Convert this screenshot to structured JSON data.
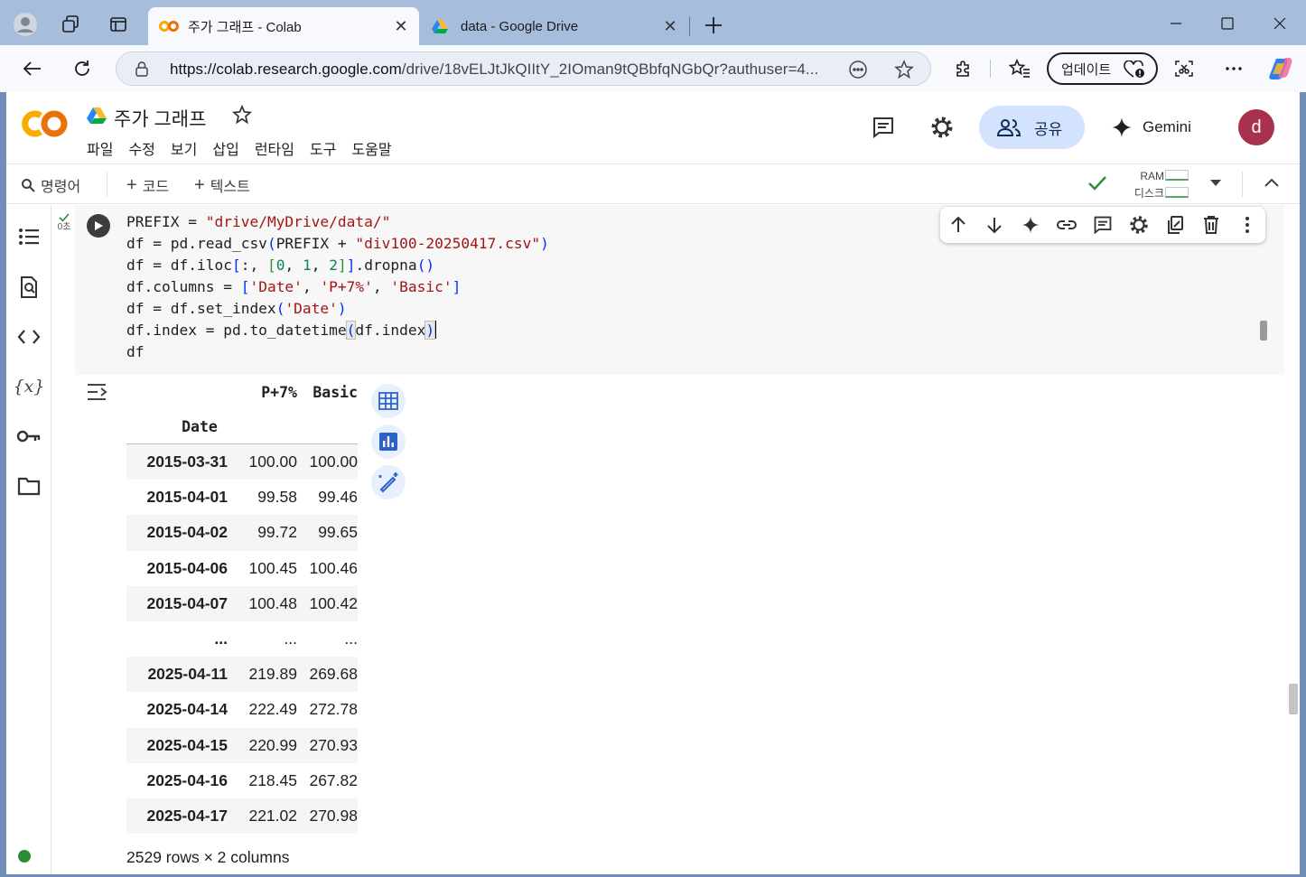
{
  "browser": {
    "tabs": [
      {
        "title": "주가 그래프 - Colab",
        "active": true
      },
      {
        "title": "data - Google Drive",
        "active": false
      }
    ],
    "url_domain": "https://colab.research.google.com",
    "url_rest": "/drive/18vELJtJkQIItY_2IOman9tQBbfqNGbQr?authuser=4...",
    "update_label": "업데이트"
  },
  "colab": {
    "notebook_title": "주가 그래프",
    "menu": [
      "파일",
      "수정",
      "보기",
      "삽입",
      "런타임",
      "도구",
      "도움말"
    ],
    "share_label": "공유",
    "gemini_label": "Gemini",
    "avatar_letter": "d",
    "toolbar": {
      "command_label": "명령어",
      "add_code_label": "코드",
      "add_text_label": "텍스트",
      "ram_label": "RAM",
      "disk_label": "디스크"
    }
  },
  "cell": {
    "exec_time": "0초",
    "code_lines": [
      "PREFIX = \"drive/MyDrive/data/\"",
      "df = pd.read_csv(PREFIX + \"div100-20250417.csv\")",
      "df = df.iloc[:, [0, 1, 2]].dropna()",
      "df.columns = ['Date', 'P+7%', 'Basic']",
      "df = df.set_index('Date')",
      "df.index = pd.to_datetime(df.index)",
      "df"
    ]
  },
  "dataframe": {
    "columns": [
      "P+7%",
      "Basic"
    ],
    "index_name": "Date",
    "rows": [
      [
        "2015-03-31",
        "100.00",
        "100.00"
      ],
      [
        "2015-04-01",
        "99.58",
        "99.46"
      ],
      [
        "2015-04-02",
        "99.72",
        "99.65"
      ],
      [
        "2015-04-06",
        "100.45",
        "100.46"
      ],
      [
        "2015-04-07",
        "100.48",
        "100.42"
      ],
      [
        "...",
        "...",
        "..."
      ],
      [
        "2025-04-11",
        "219.89",
        "269.68"
      ],
      [
        "2025-04-14",
        "222.49",
        "272.78"
      ],
      [
        "2025-04-15",
        "220.99",
        "270.93"
      ],
      [
        "2025-04-16",
        "218.45",
        "267.82"
      ],
      [
        "2025-04-17",
        "221.02",
        "270.98"
      ]
    ],
    "shape_text": "2529 rows × 2 columns"
  }
}
